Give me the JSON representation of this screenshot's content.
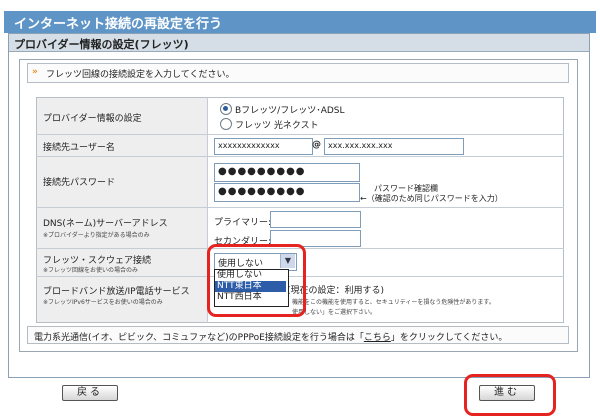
{
  "header": {
    "title": "インターネット接続の再設定を行う"
  },
  "section": {
    "title": "プロバイダー情報の設定(フレッツ)"
  },
  "instruction": {
    "icon": "double-chevron-icon",
    "text": "フレッツ回線の接続設定を入力してください。"
  },
  "form": {
    "provider": {
      "label": "プロバイダー情報の設定",
      "options": [
        "Bフレッツ/フレッツ･ADSL",
        "フレッツ 光ネクスト"
      ],
      "selected_index": 0
    },
    "username": {
      "label": "接続先ユーザー名",
      "value": "xxxxxxxxxxxxx",
      "at": "@",
      "domain": "xxx.xxx.xxx.xxx"
    },
    "password": {
      "label": "接続先パスワード",
      "value": "●●●●●●●●●",
      "confirm_value": "●●●●●●●●●",
      "confirm_label": "パスワード確認欄",
      "confirm_hint": "←（確認のため同じパスワードを入力）"
    },
    "dns": {
      "label": "DNS(ネーム)サーバーアドレス",
      "note": "※プロバイダーより指定がある場合のみ",
      "primary_label": "プライマリー:",
      "secondary_label": "セカンダリー:"
    },
    "flets_square": {
      "label": "フレッツ・スクウェア接続",
      "note": "※フレッツ回線をお使いの場合のみ",
      "selected": "使用しない",
      "options": [
        "使用しない",
        "NTT東日本",
        "NTT西日本"
      ],
      "highlight_index": 1
    },
    "broadband": {
      "label": "ブロードバンド放送/IP電話サービス",
      "note": "※フレッツIPv6サービスをお使いの場合のみ",
      "value_text": "(現在の設定：利用する)",
      "desc_line1": "機能をこの機能を使用すると、セキュリティーを損なう危険性があります。",
      "desc_line2": "使用しない」をご選択下さい。"
    }
  },
  "bottom_note": {
    "prefix": "電力系光通信(イオ、ピビック、コミュファなど)のPPPoE接続設定を行う場合は「",
    "link": "こちら",
    "suffix": "」をクリックしてください。"
  },
  "buttons": {
    "back": "戻る",
    "next": "進む"
  },
  "colors": {
    "title_bar": "#5f95c6",
    "highlight": "#2d5da8",
    "annotation_ring": "#e52320"
  }
}
